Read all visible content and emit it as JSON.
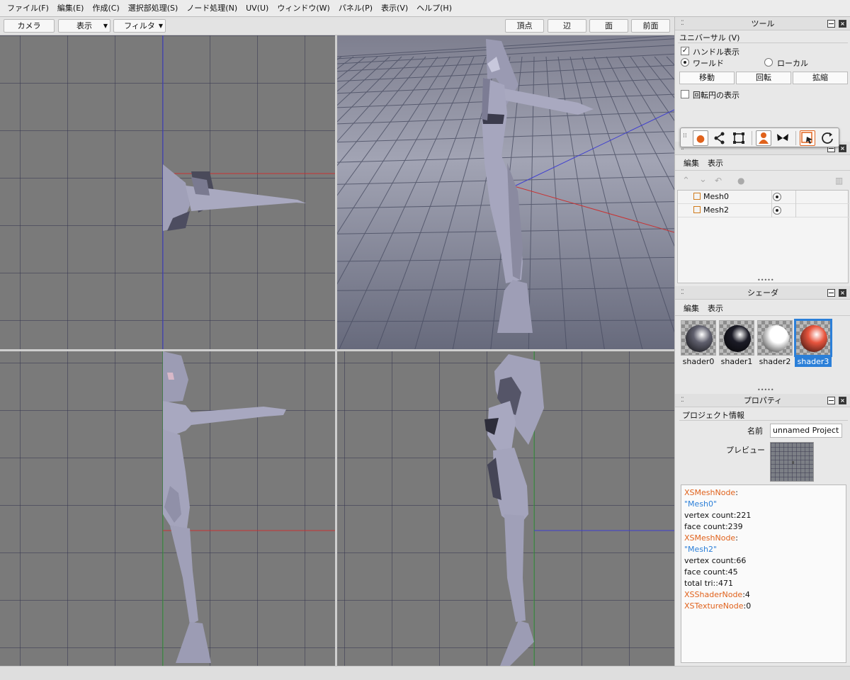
{
  "menu": {
    "items": [
      "ファイル(F)",
      "編集(E)",
      "作成(C)",
      "選択部処理(S)",
      "ノード処理(N)",
      "UV(U)",
      "ウィンドウ(W)",
      "パネル(P)",
      "表示(V)",
      "ヘルプ(H)"
    ]
  },
  "toolbar": {
    "camera": "カメラ",
    "display": "表示",
    "filter": "フィルタ",
    "vertex": "頂点",
    "edge": "辺",
    "face": "面",
    "front": "前面"
  },
  "tool_panel": {
    "title": "ツール",
    "mode": "ユニバーサル (V)",
    "show_handles": {
      "label": "ハンドル表示",
      "checked": true
    },
    "world": {
      "label": "ワールド",
      "selected": true
    },
    "local": {
      "label": "ローカル",
      "selected": false
    },
    "move": "移動",
    "rotate": "回転",
    "scale": "拡縮",
    "show_rotate_circle": {
      "label": "回転円の表示",
      "checked": false
    }
  },
  "floating_tools": {
    "icons": [
      "point-icon",
      "share-icon",
      "transform-box-icon",
      "person-icon",
      "butterfly-icon",
      "select-arrow-icon",
      "rotate-icon"
    ]
  },
  "scene_panel": {
    "menu_edit": "編集",
    "menu_view": "表示",
    "meshes": [
      {
        "name": "Mesh0",
        "visible": true
      },
      {
        "name": "Mesh2",
        "visible": true
      }
    ]
  },
  "shader_panel": {
    "title": "シェーダ",
    "menu_edit": "編集",
    "menu_view": "表示",
    "shaders": [
      {
        "name": "shader0",
        "color": "#5f5f6d",
        "selected": false
      },
      {
        "name": "shader1",
        "color": "#1b1b26",
        "selected": false
      },
      {
        "name": "shader2",
        "color": "#ffffff",
        "selected": false
      },
      {
        "name": "shader3",
        "color": "#e8553e",
        "selected": true
      }
    ]
  },
  "properties_panel": {
    "title": "プロパティ",
    "section": "プロジェクト情報",
    "name_label": "名前",
    "name_value": "unnamed Project",
    "preview_label": "プレビュー",
    "info": [
      {
        "key": "XSMeshNode",
        "rest": ":"
      },
      {
        "str": "\"Mesh0\""
      },
      {
        "text": "vertex count:221"
      },
      {
        "text": "face count:239"
      },
      {
        "key": "XSMeshNode",
        "rest": ":"
      },
      {
        "str": "\"Mesh2\""
      },
      {
        "text": "vertex count:66"
      },
      {
        "text": "face count:45"
      },
      {
        "text": "total tri::471"
      },
      {
        "key": "XSShaderNode",
        "rest": ":4"
      },
      {
        "key": "XSTextureNode",
        "rest": ":0"
      }
    ]
  },
  "colors": {
    "accent": "#2b7fd8",
    "tool_orange": "#e0621c",
    "viewport_bg": "#7a7a7a",
    "model_fill": "#9b9bb3"
  }
}
